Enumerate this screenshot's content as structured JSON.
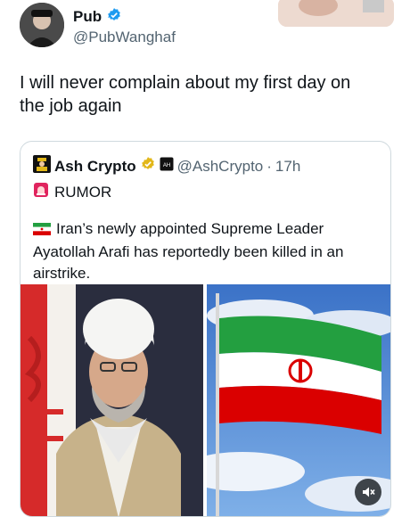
{
  "tweet": {
    "author_name": "Pub",
    "author_handle": "@PubWanghaf",
    "text": "I will never complain about my first day on the job again"
  },
  "quoted": {
    "author_name": "Ash Crypto",
    "author_handle": "@AshCrypto",
    "separator": "·",
    "time": "17h",
    "tag": "RUMOR",
    "text": "Iran’s newly appointed Supreme Leader Ayatollah Arafi has reportedly been killed in an airstrike."
  },
  "icons": {
    "verified": "verified-badge-icon",
    "gold_verified": "gold-verified-badge-icon",
    "rumor": "siren-icon",
    "flag": "iran-flag-icon",
    "mute": "volume-muted-icon"
  },
  "colors": {
    "verified": "#1d9bf0",
    "gold": "#e2b719",
    "rumor": "#e0245e",
    "flag_green": "#239f40",
    "flag_red": "#da0000"
  }
}
